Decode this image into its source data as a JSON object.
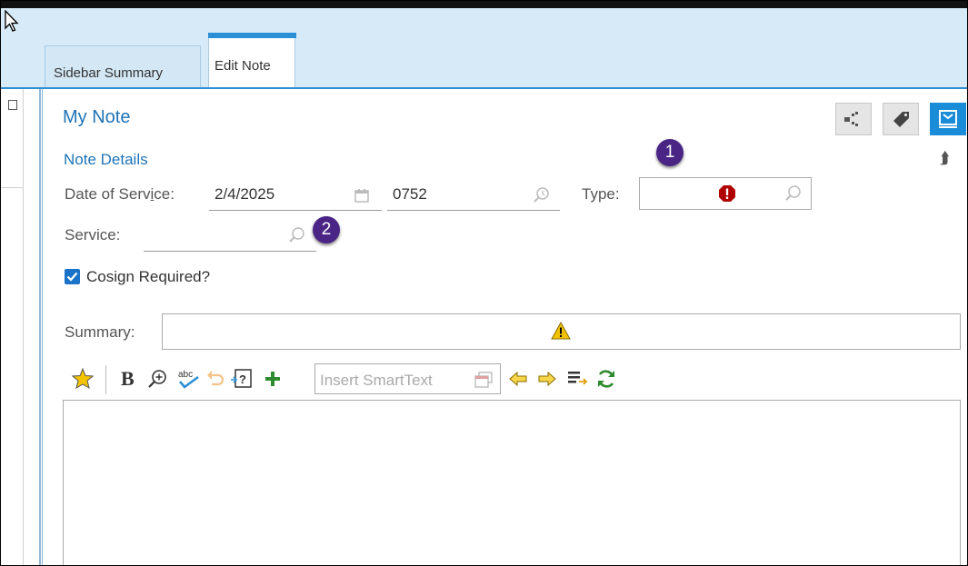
{
  "tabs": [
    {
      "label": "Sidebar Summary"
    },
    {
      "label": "Edit Note"
    }
  ],
  "note": {
    "title": "My Note",
    "section_title": "Note Details",
    "date_label_pre": "Date of Serv",
    "date_label_ul": "i",
    "date_label_post": "ce:",
    "date_value": "2/4/2025",
    "time_value": "0752",
    "type_label": "Type:",
    "type_value": "",
    "service_label": "Service:",
    "service_value": "",
    "cosign_label": "Cosign Required?",
    "cosign_checked": true,
    "summary_label": "Summary:",
    "summary_value": ""
  },
  "callouts": [
    "1",
    "2"
  ],
  "editor": {
    "smarttext_placeholder": "Insert SmartText",
    "toolbar_icons": [
      "favorite-star-icon",
      "bold-icon",
      "zoom-icon",
      "spellcheck-icon",
      "undo-icon",
      "insert-field-icon",
      "add-icon",
      "insert-smarttext-icon",
      "previous-icon",
      "next-icon",
      "list-icon",
      "refresh-icon"
    ]
  },
  "colors": {
    "accent": "#1f73b7",
    "tab_highlight": "#2b8fd6",
    "error": "#b00000",
    "warning": "#f2c200",
    "callout": "#4a2585",
    "add": "#2e8b2e",
    "refresh": "#2e8b2e"
  }
}
